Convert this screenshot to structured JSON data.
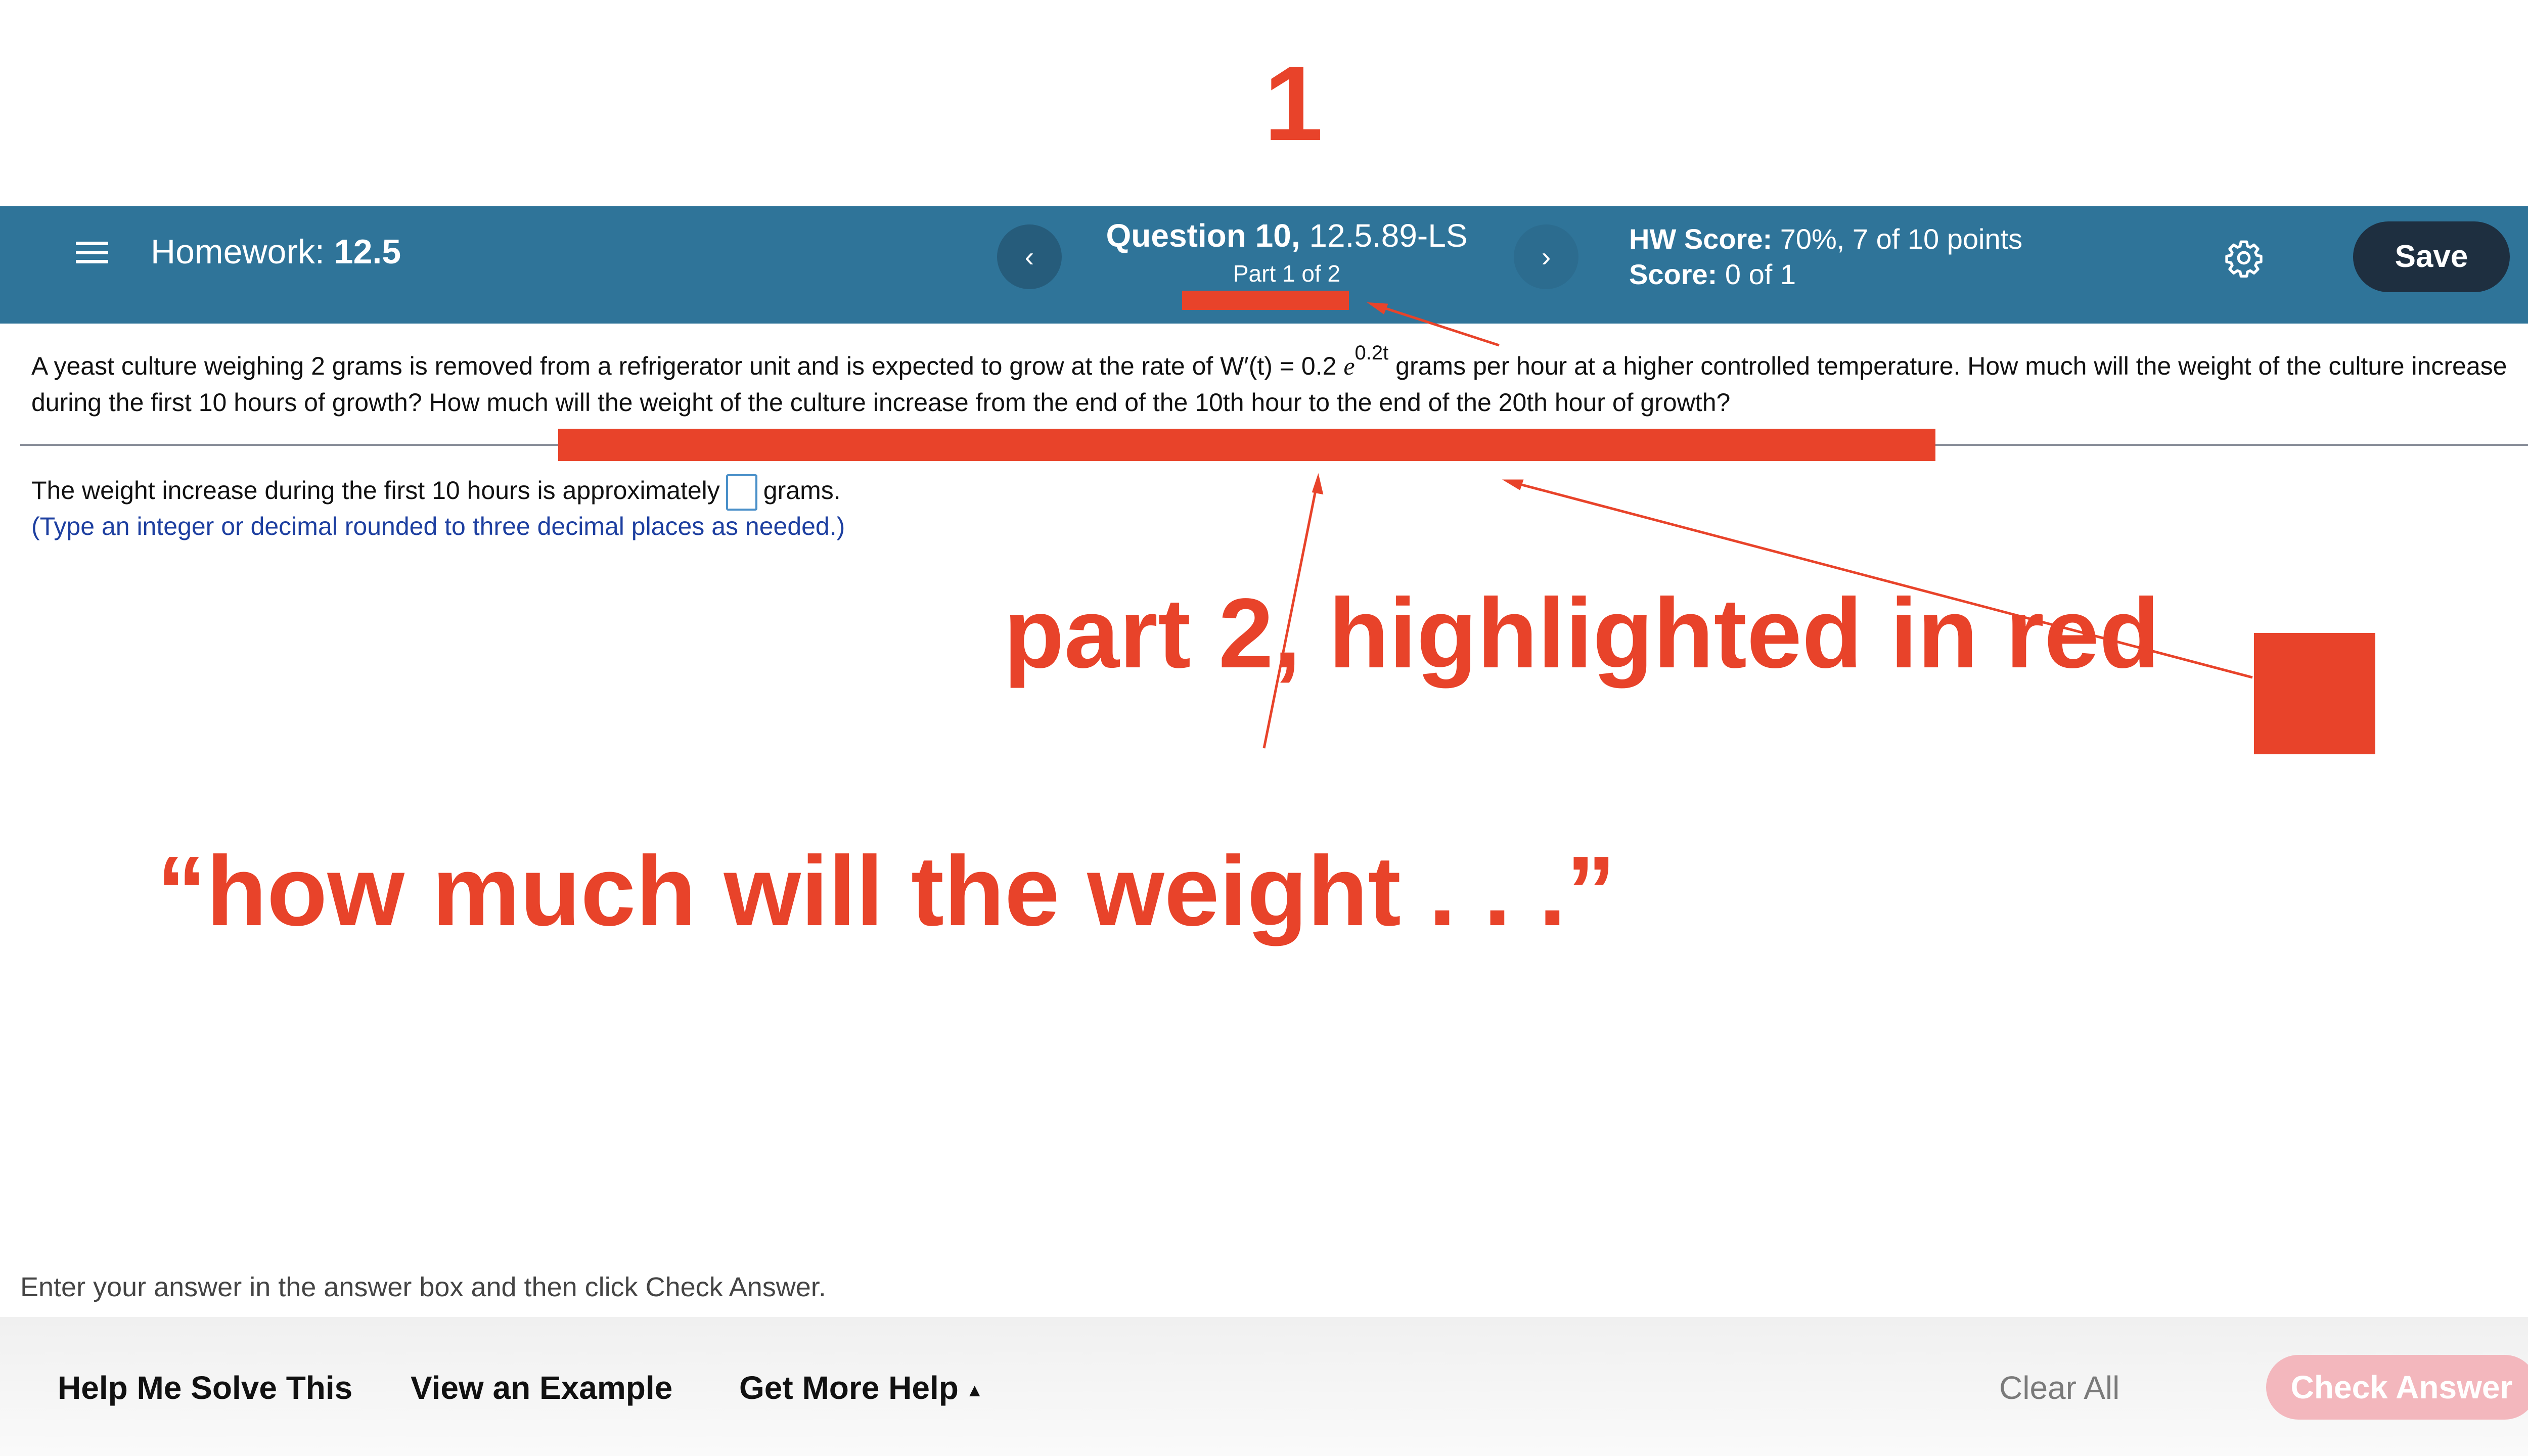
{
  "annotations": {
    "number_label": "1",
    "part2_note": "part 2, highlighted in red",
    "quote_note": "“how much will the weight . . .”",
    "accent_color": "#e8432a"
  },
  "header": {
    "homework_label": "Homework:",
    "homework_value": "12.5",
    "question_label": "Question 10,",
    "question_code": "12.5.89-LS",
    "part": "Part 1 of 2",
    "hw_score_label": "HW Score:",
    "hw_score_value": "70%, 7 of 10 points",
    "score_label": "Score:",
    "score_value": "0 of 1",
    "save_label": "Save",
    "prev_symbol": "‹",
    "next_symbol": "›",
    "background_color": "#2f7499"
  },
  "question": {
    "text_before_formula": "A yeast culture weighing 2 grams is removed from a refrigerator unit and is expected to grow at the rate of W′(t) = 0.2",
    "formula_base": "e",
    "formula_exponent": "0.2t",
    "text_after_formula": "grams per hour at a higher controlled temperature.  How much will the weight of the culture increase during the first 10 hours of growth?  How much will the weight of the culture increase from the end of the 10th hour to the end of the 20th hour of growth?"
  },
  "answer": {
    "prefix": "The weight increase during the first 10 hours is approximately",
    "value": "",
    "suffix": "grams.",
    "hint": "(Type an integer or decimal rounded to three decimal places as needed.)"
  },
  "instruction": "Enter your answer in the answer box and then click Check Answer.",
  "footer": {
    "help_me_solve": "Help Me Solve This",
    "view_example": "View an Example",
    "get_more_help": "Get More Help",
    "more_help_caret": "▲",
    "clear_all": "Clear All",
    "check_answer": "Check Answer"
  }
}
